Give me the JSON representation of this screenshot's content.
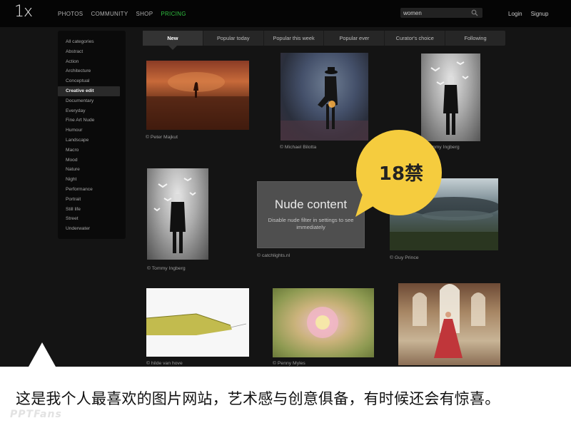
{
  "topbar": {
    "logo": "1x",
    "nav": [
      "PHOTOS",
      "COMMUNITY",
      "SHOP",
      "PRICING"
    ],
    "active_nav": "PRICING",
    "search_value": "women",
    "login": "Login",
    "signup": "Signup"
  },
  "sidebar": {
    "categories": [
      "All categories",
      "Abstract",
      "Action",
      "Architecture",
      "Conceptual",
      "Creative edit",
      "Documentary",
      "Everyday",
      "Fine Art Nude",
      "Humour",
      "Landscape",
      "Macro",
      "Mood",
      "Nature",
      "Night",
      "Performance",
      "Portrait",
      "Still life",
      "Street",
      "Underwater"
    ],
    "active": "Creative edit"
  },
  "tabs": {
    "items": [
      "New",
      "Popular today",
      "Popular this week",
      "Popular ever",
      "Curator's choice",
      "Following"
    ],
    "active": "New"
  },
  "photos": [
    {
      "credit": "© Peter Majkut"
    },
    {
      "credit": "© Michael Bilotta"
    },
    {
      "credit": "© Tommy Ingberg"
    },
    {
      "credit": "© Tommy Ingberg"
    },
    {
      "credit": "© catchlights.nl"
    },
    {
      "credit": "© Guy Prince"
    },
    {
      "credit": "© hilde van hove"
    },
    {
      "credit": "© Penny Myles"
    }
  ],
  "nude_overlay": {
    "title": "Nude content",
    "subtitle": "Disable nude filter in settings to see immediately"
  },
  "badge": {
    "text": "18禁",
    "color": "#f5cc3e"
  },
  "caption": "这是我个人最喜欢的图片网站，艺术感与创意俱备，有时候还会有惊喜。",
  "watermark": "PPTFans",
  "colors": {
    "accent": "#2fbf3f",
    "background": "#141414"
  }
}
